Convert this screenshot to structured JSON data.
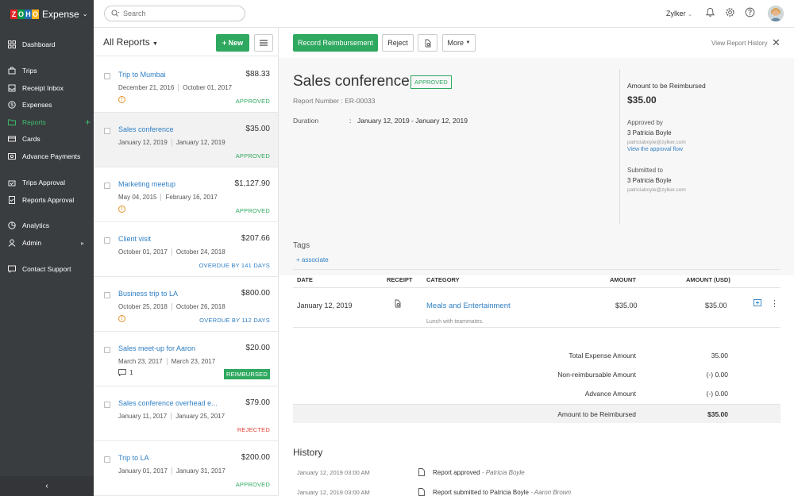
{
  "app": {
    "logo_letters": [
      "Z",
      "O",
      "H",
      "O"
    ],
    "logo_colors": [
      "#e42527",
      "#089949",
      "#226db4",
      "#f9b21d"
    ],
    "product": "Expense",
    "search_placeholder": "Search",
    "org": "Zylker"
  },
  "sidebar": {
    "items": [
      {
        "label": "Dashboard",
        "icon": "dashboard-icon"
      },
      {
        "label": "Trips",
        "icon": "trips-icon"
      },
      {
        "label": "Receipt Inbox",
        "icon": "receipt-inbox-icon"
      },
      {
        "label": "Expenses",
        "icon": "expenses-icon"
      },
      {
        "label": "Reports",
        "icon": "reports-icon"
      },
      {
        "label": "Cards",
        "icon": "cards-icon"
      },
      {
        "label": "Advance Payments",
        "icon": "advance-payments-icon"
      },
      {
        "label": "Trips Approval",
        "icon": "trips-approval-icon"
      },
      {
        "label": "Reports Approval",
        "icon": "reports-approval-icon"
      },
      {
        "label": "Analytics",
        "icon": "analytics-icon"
      },
      {
        "label": "Admin",
        "icon": "admin-icon"
      },
      {
        "label": "Contact Support",
        "icon": "contact-support-icon"
      }
    ],
    "collapse_glyph": "‹"
  },
  "list": {
    "title": "All Reports",
    "new_label": "New",
    "reports": [
      {
        "name": "Trip to Mumbai",
        "amount": "$88.33",
        "from": "December 21, 2016",
        "to": "October 01, 2017",
        "status": "APPROVED",
        "flag": "warn"
      },
      {
        "name": "Sales conference",
        "amount": "$35.00",
        "from": "January 12, 2019",
        "to": "January 12, 2019",
        "status": "APPROVED",
        "flag": ""
      },
      {
        "name": "Marketing meetup",
        "amount": "$1,127.90",
        "from": "May 04, 2015",
        "to": "February 16, 2017",
        "status": "APPROVED",
        "flag": "warn"
      },
      {
        "name": "Client visit",
        "amount": "$207.66",
        "from": "October 01, 2017",
        "to": "October 24, 2018",
        "status": "OVERDUE BY 141 DAYS",
        "flag": ""
      },
      {
        "name": "Business trip to LA",
        "amount": "$800.00",
        "from": "October 25, 2018",
        "to": "October 26, 2018",
        "status": "OVERDUE BY 112 DAYS",
        "flag": "warn"
      },
      {
        "name": "Sales meet-up for Aaron",
        "amount": "$20.00",
        "from": "March 23, 2017",
        "to": "March 23, 2017",
        "status": "REIMBURSED",
        "flag": "comment",
        "comments": "1"
      },
      {
        "name": "Sales conference overhead e...",
        "amount": "$79.00",
        "from": "January 11, 2017",
        "to": "January 25, 2017",
        "status": "REJECTED",
        "flag": ""
      },
      {
        "name": "Trip to LA",
        "amount": "$200.00",
        "from": "January 01, 2017",
        "to": "January 31, 2017",
        "status": "APPROVED",
        "flag": ""
      }
    ]
  },
  "detail": {
    "toolbar": {
      "record": "Record Reimbursement",
      "reject": "Reject",
      "more": "More",
      "history_link": "View Report History"
    },
    "title": "Sales conference",
    "status": "APPROVED",
    "report_number": "Report Number : ER-00033",
    "duration_label": "Duration",
    "duration_value": "January 12, 2019  -  January 12, 2019",
    "tags_label": "Tags",
    "tags_add": "+ associate",
    "summary": {
      "reimb_label": "Amount to be Reimbursed",
      "reimb_amount": "$35.00",
      "approved_by_label": "Approved by",
      "approved_by_name": "3  Patricia Boyle",
      "approved_by_email": "patriciaboyle@zylker.com",
      "approval_flow_link": "View the approval flow",
      "submitted_to_label": "Submitted to",
      "submitted_to_name": "3  Patricia Boyle",
      "submitted_to_email": "patriciaboyle@zylker.com"
    },
    "table": {
      "headers": {
        "date": "DATE",
        "receipt": "RECEIPT",
        "category": "CATEGORY",
        "amount": "AMOUNT",
        "amount_usd": "AMOUNT (USD)"
      },
      "rows": [
        {
          "date": "January 12, 2019",
          "category": "Meals and Entertainment",
          "note": "Lunch with teammates.",
          "amount": "$35.00",
          "amount_usd": "$35.00"
        }
      ]
    },
    "totals": [
      {
        "label": "Total Expense Amount",
        "value": "35.00"
      },
      {
        "label": "Non-reimbursable Amount",
        "value": "(-) 0.00"
      },
      {
        "label": "Advance Amount",
        "value": "(-) 0.00"
      },
      {
        "label": "Amount to be Reimbursed",
        "value": "$35.00"
      }
    ],
    "history_title": "History",
    "history": [
      {
        "time": "January 12, 2019 03:00 AM",
        "text": "Report approved",
        "by": "- Patricia Boyle"
      },
      {
        "time": "January 12, 2019 03:00 AM",
        "text": "Report submitted to Patricia Boyle",
        "by": "- Aaron Brown"
      }
    ]
  }
}
